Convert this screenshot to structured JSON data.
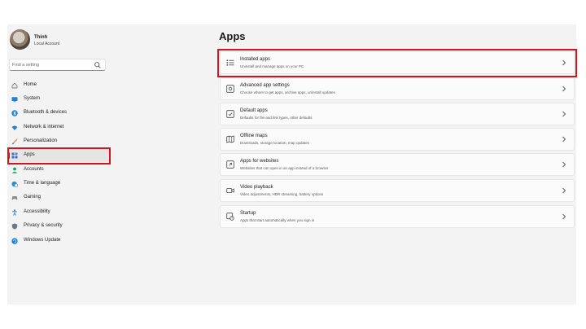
{
  "profile": {
    "name": "Thinh",
    "account_type": "Local Account"
  },
  "search": {
    "placeholder": "Find a setting"
  },
  "nav": {
    "items": [
      {
        "label": "Home",
        "icon": "home-icon"
      },
      {
        "label": "System",
        "icon": "monitor-icon"
      },
      {
        "label": "Bluetooth & devices",
        "icon": "bluetooth-icon"
      },
      {
        "label": "Network & internet",
        "icon": "wifi-icon"
      },
      {
        "label": "Personalization",
        "icon": "brush-icon"
      },
      {
        "label": "Apps",
        "icon": "apps-icon",
        "selected": true
      },
      {
        "label": "Accounts",
        "icon": "person-icon"
      },
      {
        "label": "Time & language",
        "icon": "globe-clock-icon"
      },
      {
        "label": "Gaming",
        "icon": "gamepad-icon"
      },
      {
        "label": "Accessibility",
        "icon": "accessibility-icon"
      },
      {
        "label": "Privacy & security",
        "icon": "shield-icon"
      },
      {
        "label": "Windows Update",
        "icon": "update-icon"
      }
    ]
  },
  "main": {
    "title": "Apps",
    "cards": [
      {
        "title": "Installed apps",
        "desc": "Uninstall and manage apps on your PC",
        "icon": "list-icon"
      },
      {
        "title": "Advanced app settings",
        "desc": "Choose where to get apps, archive apps, uninstall updates",
        "icon": "app-settings-icon"
      },
      {
        "title": "Default apps",
        "desc": "Defaults for file and link types, other defaults",
        "icon": "default-apps-icon"
      },
      {
        "title": "Offline maps",
        "desc": "Downloads, storage location, map updates",
        "icon": "map-icon"
      },
      {
        "title": "Apps for websites",
        "desc": "Websites that can open in an app instead of a browser",
        "icon": "web-apps-icon"
      },
      {
        "title": "Video playback",
        "desc": "Video adjustments, HDR streaming, battery options",
        "icon": "video-icon"
      },
      {
        "title": "Startup",
        "desc": "Apps that start automatically when you sign in",
        "icon": "startup-icon"
      }
    ]
  },
  "colors": {
    "accent": "#0067c0",
    "highlight_box": "#d0151d",
    "window_bg": "#f3f3f3"
  }
}
